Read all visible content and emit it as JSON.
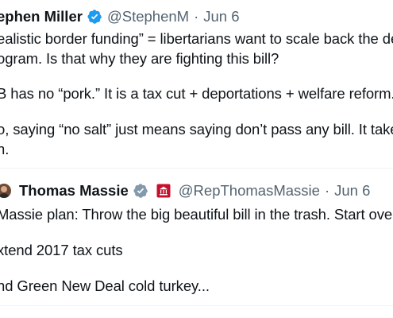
{
  "tweets": [
    {
      "display_name": "ephen Miller",
      "handle": "@StephenM",
      "separator": "·",
      "date": "Jun 6",
      "verified": true,
      "body_lines": [
        "ealistic border funding” = libertarians want to scale back the dep",
        "ogram. Is that why they are fighting this bill?",
        "B has no “pork.” It is a tax cut + deportations + welfare reform.",
        "o, saying “no salt” just means saying don’t pass any bill. It takes",
        "n."
      ]
    },
    {
      "display_name": "Thomas Massie",
      "handle": "@RepThomasMassie",
      "separator": "·",
      "date": "Jun 6",
      "verified": true,
      "affiliation_icon": "congress-badge-icon",
      "body_lines": [
        "Massie plan: Throw the big beautiful bill in the trash. Start over...",
        "xtend 2017 tax cuts",
        "nd Green New Deal cold turkey..."
      ]
    }
  ],
  "colors": {
    "text": "#0f1419",
    "secondary": "#536471",
    "verified_blue": "#1d9bf0",
    "affiliation_red": "#c8102e",
    "divider": "#eff3f4"
  }
}
